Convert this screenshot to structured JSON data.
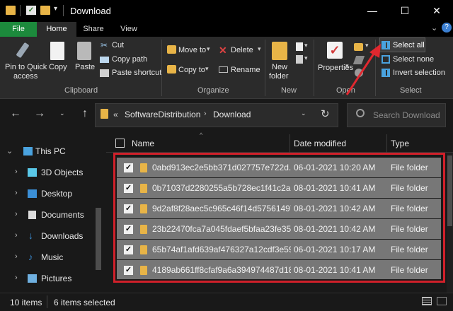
{
  "window": {
    "title": "Download",
    "minimize": "—",
    "maximize": "☐",
    "close": "✕"
  },
  "tabs": [
    "File",
    "Home",
    "Share",
    "View"
  ],
  "ribbon": {
    "clipboard": {
      "pin": [
        "Pin to Quick",
        "access"
      ],
      "copy": "Copy",
      "paste": "Paste",
      "cut": "Cut",
      "copy_path": "Copy path",
      "paste_shortcut": "Paste shortcut",
      "group": "Clipboard"
    },
    "organize": {
      "move_to": "Move to",
      "copy_to": "Copy to",
      "delete": "Delete",
      "rename": "Rename",
      "group": "Organize"
    },
    "new": {
      "new_folder": [
        "New",
        "folder"
      ],
      "group": "New"
    },
    "open": {
      "properties": "Properties",
      "group": "Open"
    },
    "select": {
      "select_all": "Select all",
      "select_none": "Select none",
      "invert": "Invert selection",
      "group": "Select"
    }
  },
  "address": {
    "prefix": "«",
    "crumbs": [
      "SoftwareDistribution",
      "Download"
    ],
    "search_placeholder": "Search Download"
  },
  "nav": [
    {
      "label": "This PC",
      "icon": "pc-icon",
      "expanded": true
    },
    {
      "label": "3D Objects",
      "icon": "cube-icon"
    },
    {
      "label": "Desktop",
      "icon": "desktop-icon"
    },
    {
      "label": "Documents",
      "icon": "documents-icon"
    },
    {
      "label": "Downloads",
      "icon": "download-icon"
    },
    {
      "label": "Music",
      "icon": "music-icon"
    },
    {
      "label": "Pictures",
      "icon": "pictures-icon"
    }
  ],
  "columns": [
    "Name",
    "Date modified",
    "Type"
  ],
  "files": [
    {
      "name": "0abd913ec2e5bb371d027757e722d...",
      "date": "06-01-2021 10:20 AM",
      "type": "File folder"
    },
    {
      "name": "0b71037d2280255a5b728ec1f41c2a...",
      "date": "08-01-2021 10:41 AM",
      "type": "File folder"
    },
    {
      "name": "9d2af8f28aec5c965c46f14d57561497",
      "date": "08-01-2021 10:42 AM",
      "type": "File folder"
    },
    {
      "name": "23b22470fca7a045fdaef5bfaa23fe35",
      "date": "08-01-2021 10:42 AM",
      "type": "File folder"
    },
    {
      "name": "65b74af1afd639af476327a12cdf3e59",
      "date": "06-01-2021 10:17 AM",
      "type": "File folder"
    },
    {
      "name": "4189ab661ff8cfaf9a6a394974487d18",
      "date": "08-01-2021 10:41 AM",
      "type": "File folder"
    }
  ],
  "status": {
    "items": "10 items",
    "selected": "6 items selected"
  },
  "colors": {
    "accent_red": "#d1202a",
    "file_tab": "#1c8a3c",
    "folder": "#e8b447"
  }
}
